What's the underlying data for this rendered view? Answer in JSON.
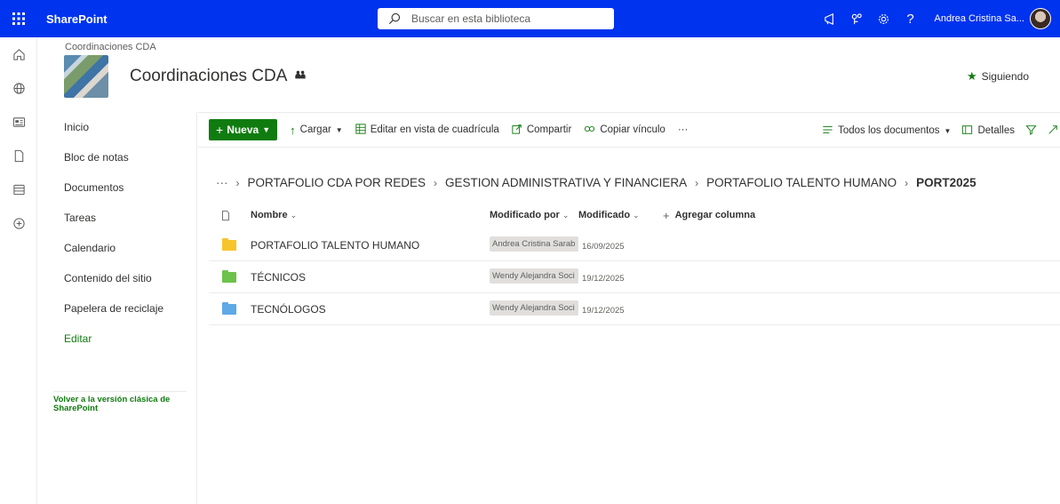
{
  "suite": {
    "app_name": "SharePoint",
    "search_placeholder": "Buscar en esta biblioteca",
    "user_name": "Andrea Cristina Sa..."
  },
  "site": {
    "breadcrumb": "Coordinaciones CDA",
    "title": "Coordinaciones CDA",
    "follow_label": "Siguiendo"
  },
  "nav": {
    "items": [
      "Inicio",
      "Bloc de notas",
      "Documentos",
      "Tareas",
      "Calendario",
      "Contenido del sitio",
      "Papelera de reciclaje"
    ],
    "edit_label": "Editar",
    "classic_link": "Volver a la versión clásica de SharePoint"
  },
  "commands": {
    "new": "Nueva",
    "upload": "Cargar",
    "grid_edit": "Editar en vista de cuadrícula",
    "share": "Compartir",
    "copy_link": "Copiar vínculo",
    "more": "···",
    "view": "Todos los documentos",
    "details": "Detalles"
  },
  "breadcrumb": {
    "more": "···",
    "items": [
      "PORTAFOLIO CDA POR REDES",
      "GESTION ADMINISTRATIVA Y FINANCIERA",
      "PORTAFOLIO TALENTO HUMANO"
    ],
    "current": "PORT2025"
  },
  "columns": {
    "name": "Nombre",
    "modified_by": "Modificado por",
    "modified": "Modificado",
    "add_column": "Agregar columna"
  },
  "rows": [
    {
      "name": "PORTAFOLIO TALENTO HUMANO",
      "modified_by": "Andrea Cristina Sarab",
      "modified": "16/09/2025",
      "folder_color": "#f8c42b"
    },
    {
      "name": "TÉCNICOS",
      "modified_by": "Wendy Alejandra Soci",
      "modified": "19/12/2025",
      "folder_color": "#6cc24a"
    },
    {
      "name": "TECNÓLOGOS",
      "modified_by": "Wendy Alejandra Soci",
      "modified": "19/12/2025",
      "folder_color": "#5ea9e6"
    }
  ],
  "colors": {
    "suite_blue": "#0033ee",
    "brand_green": "#107c10"
  }
}
